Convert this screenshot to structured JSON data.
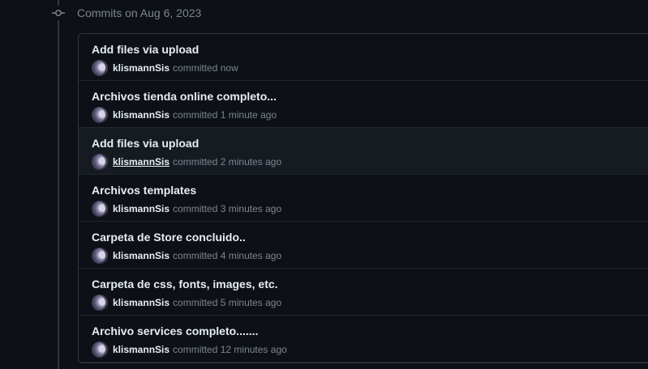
{
  "group": {
    "date_label": "Commits on Aug 6, 2023",
    "commits": [
      {
        "title": "Add files via upload",
        "author": "klismannSis",
        "verb": "committed",
        "time": "now"
      },
      {
        "title": "Archivos tienda online completo...",
        "author": "klismannSis",
        "verb": "committed",
        "time": "1 minute ago"
      },
      {
        "title": "Add files via upload",
        "author": "klismannSis",
        "verb": "committed",
        "time": "2 minutes ago"
      },
      {
        "title": "Archivos templates",
        "author": "klismannSis",
        "verb": "committed",
        "time": "3 minutes ago"
      },
      {
        "title": "Carpeta de Store concluido..",
        "author": "klismannSis",
        "verb": "committed",
        "time": "4 minutes ago"
      },
      {
        "title": "Carpeta de css, fonts, images, etc.",
        "author": "klismannSis",
        "verb": "committed",
        "time": "5 minutes ago"
      },
      {
        "title": "Archivo services completo.......",
        "author": "klismannSis",
        "verb": "committed",
        "time": "12 minutes ago"
      }
    ]
  },
  "colors": {
    "background": "#0d1117",
    "border": "#30363d",
    "text_primary": "#e6edf3",
    "text_muted": "#7d8590",
    "row_hover": "#161b22"
  },
  "icons": {
    "timeline_node": "git-commit-icon"
  }
}
